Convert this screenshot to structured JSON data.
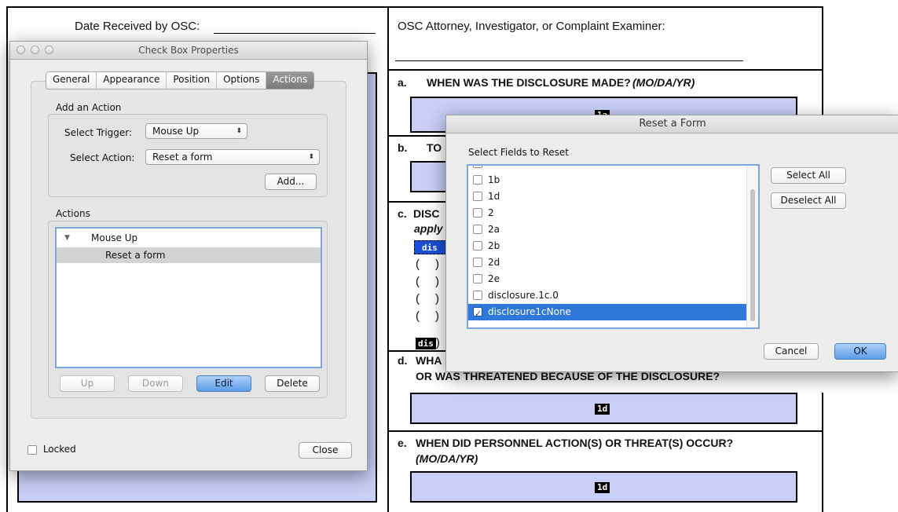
{
  "form": {
    "date_received_label": "Date Received by OSC:",
    "osc_attorney_label": "OSC Attorney, Investigator, or Complaint Examiner:",
    "sections": [
      {
        "letter": "a.",
        "title": "WHEN WAS THE DISCLOSURE MADE?",
        "subtitle": "(MO/DA/YR)",
        "field_tag": "1a"
      },
      {
        "letter": "b.",
        "title": "TO"
      },
      {
        "letter": "c.",
        "title": "DISC",
        "line2": "apply"
      },
      {
        "letter": "d.",
        "title": "WHA",
        "line2": "OR WAS THREATENED BECAUSE OF THE DISCLOSURE?",
        "field_tag": "1d"
      },
      {
        "letter": "e.",
        "title": "WHEN DID PERSONNEL ACTION(S) OR THREAT(S) OCCUR?",
        "subtitle": "(MO/DA/YR)",
        "field_tag": "1d"
      }
    ],
    "paren_open": "(",
    "paren_close": ")",
    "dis_tag": "dis",
    "dis_tag_selected": "dis"
  },
  "check_box_properties": {
    "title": "Check Box Properties",
    "tabs": [
      "General",
      "Appearance",
      "Position",
      "Options",
      "Actions"
    ],
    "active_tab": "Actions",
    "add_action": {
      "heading": "Add an Action",
      "trigger_label": "Select Trigger:",
      "trigger_value": "Mouse Up",
      "action_label": "Select Action:",
      "action_value": "Reset a form",
      "add_button": "Add..."
    },
    "actions": {
      "heading": "Actions",
      "tree": [
        {
          "label": "Mouse Up",
          "expanded": true,
          "children": [
            {
              "label": "Reset a form",
              "selected": true
            }
          ]
        }
      ],
      "buttons": {
        "up": "Up",
        "down": "Down",
        "edit": "Edit",
        "delete": "Delete"
      }
    },
    "locked_label": "Locked",
    "locked_checked": false,
    "close_button": "Close"
  },
  "reset_form": {
    "title": "Reset a Form",
    "fields_heading": "Select Fields to Reset",
    "fields": [
      {
        "label": "",
        "checked": false
      },
      {
        "label": "1b",
        "checked": false
      },
      {
        "label": "1d",
        "checked": false
      },
      {
        "label": "2",
        "checked": false
      },
      {
        "label": "2a",
        "checked": false
      },
      {
        "label": "2b",
        "checked": false
      },
      {
        "label": "2d",
        "checked": false
      },
      {
        "label": "2e",
        "checked": false
      },
      {
        "label": "disclosure.1c.0",
        "checked": false
      },
      {
        "label": "disclosure1cNone",
        "checked": true,
        "selected": true
      }
    ],
    "select_all": "Select All",
    "deselect_all": "Deselect All",
    "cancel": "Cancel",
    "ok": "OK"
  }
}
